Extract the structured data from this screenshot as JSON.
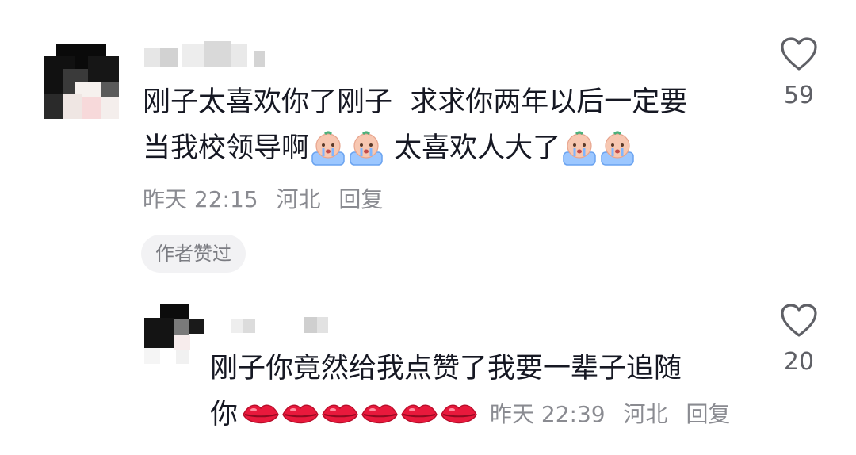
{
  "comments": [
    {
      "text_line1": "刚子太喜欢你了刚子  求求你两年以后一定要",
      "text_line2_part1": "当我校领导啊",
      "text_line2_part2": " 太喜欢人大了",
      "emoji_group1": "crying-baby-emoji",
      "emoji_group2": "crying-baby-emoji",
      "time": "昨天 22:15",
      "location": "河北",
      "reply_label": "回复",
      "badge": "作者赞过",
      "likes": "59"
    },
    {
      "text_line1": "刚子你竟然给我点赞了我要一辈子追随",
      "text_line2": "你",
      "emoji": "lips-emoji",
      "time": "昨天 22:39",
      "location": "河北",
      "reply_label": "回复",
      "likes": "20"
    }
  ],
  "colors": {
    "text": "#161823",
    "meta": "#8a8b91",
    "badge_bg": "#f2f2f4",
    "like_icon": "#5f6066"
  }
}
